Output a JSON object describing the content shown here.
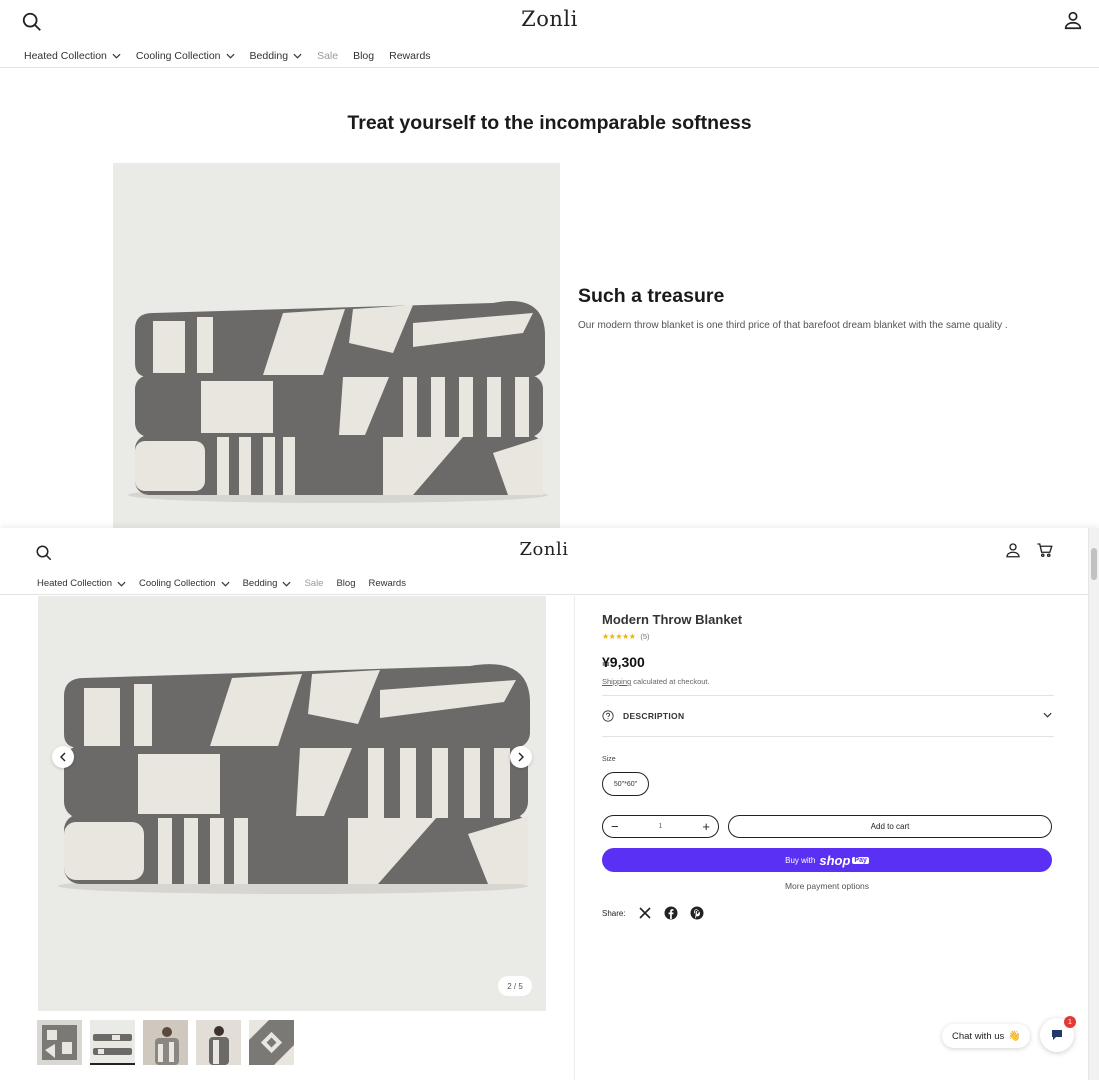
{
  "header_top": {
    "logo": "Zonli",
    "nav": [
      {
        "label": "Heated Collection",
        "has_menu": true
      },
      {
        "label": "Cooling Collection",
        "has_menu": true
      },
      {
        "label": "Bedding",
        "has_menu": true
      },
      {
        "label": "Sale",
        "has_menu": false
      },
      {
        "label": "Blog",
        "has_menu": false
      },
      {
        "label": "Rewards",
        "has_menu": false
      }
    ]
  },
  "feature": {
    "headline": "Treat yourself to the incomparable softness",
    "title": "Such a treasure",
    "text": "Our modern throw blanket is one third price of that barefoot dream blanket with the same quality ."
  },
  "header_product": {
    "logo": "Zonli",
    "nav": [
      {
        "label": "Heated Collection",
        "has_menu": true
      },
      {
        "label": "Cooling Collection",
        "has_menu": true
      },
      {
        "label": "Bedding",
        "has_menu": true
      },
      {
        "label": "Sale",
        "has_menu": false
      },
      {
        "label": "Blog",
        "has_menu": false
      },
      {
        "label": "Rewards",
        "has_menu": false
      }
    ]
  },
  "gallery": {
    "counter": "2 / 5",
    "thumbnail_count": 5,
    "active_thumbnail": 2
  },
  "product": {
    "title": "Modern Throw Blanket",
    "stars": "★★★★★",
    "rating": 5,
    "review_count": "(5)",
    "price": "¥9,300",
    "shipping_link": "Shipping",
    "shipping_note": "calculated at checkout.",
    "description_label": "DESCRIPTION",
    "size_label": "Size",
    "size_value": "50\"*60\"",
    "quantity_minus": "−",
    "quantity": "1",
    "quantity_plus": "+",
    "add_to_cart": "Add to cart",
    "buy_with": "Buy with",
    "shop_brand": "shop",
    "shop_pay": "Pay",
    "more_payment": "More payment options",
    "share_label": "Share:"
  },
  "chat": {
    "label": "Chat with us",
    "wave": "👋",
    "badge": "1"
  },
  "colors": {
    "accent": "#5a31f4",
    "blanket_dark": "#6b6a68",
    "blanket_light": "#e9e6e0",
    "photo_bg": "#eaeae6",
    "badge": "#e53935"
  },
  "icons": [
    "search-icon",
    "account-icon",
    "cart-icon",
    "chevron-down-icon",
    "chevron-left-icon",
    "chevron-right-icon",
    "question-icon",
    "x-icon",
    "facebook-icon",
    "pinterest-icon",
    "chat-icon"
  ]
}
